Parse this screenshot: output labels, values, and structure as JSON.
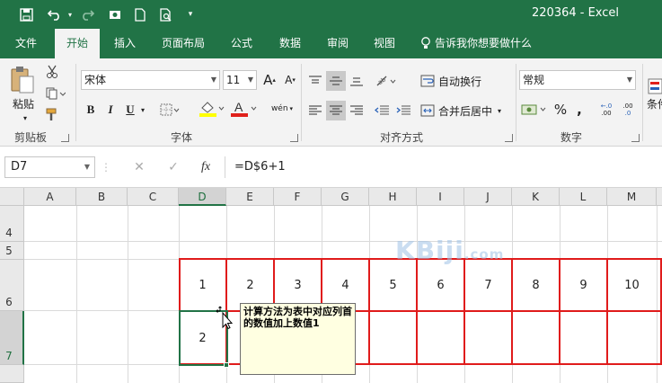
{
  "window": {
    "title": "220364 - Excel"
  },
  "quick_access": {
    "save_icon": "save-icon",
    "undo_icon": "undo-icon",
    "redo_icon": "redo-icon",
    "customize": "▾"
  },
  "tabs": [
    {
      "label": "文件"
    },
    {
      "label": "开始"
    },
    {
      "label": "插入"
    },
    {
      "label": "页面布局"
    },
    {
      "label": "公式"
    },
    {
      "label": "数据"
    },
    {
      "label": "审阅"
    },
    {
      "label": "视图"
    }
  ],
  "tell_me": "告诉我你想要做什么",
  "ribbon": {
    "clipboard": {
      "paste_label": "粘贴",
      "group_label": "剪贴板"
    },
    "font": {
      "name": "宋体",
      "size": "11",
      "bold": "B",
      "italic": "I",
      "underline": "U",
      "grow": "A",
      "shrink": "A",
      "phonetic": "wén",
      "group_label": "字体"
    },
    "alignment": {
      "wrap_text": "自动换行",
      "merge_center": "合并后居中",
      "group_label": "对齐方式"
    },
    "number": {
      "format": "常规",
      "percent": "%",
      "comma": ",",
      "inc_decimal": ".00",
      "dec_decimal": ".0",
      "group_label": "数字"
    },
    "styles": {
      "conditional_partial": "条件"
    }
  },
  "formula_bar": {
    "name_box": "D7",
    "fx": "fx",
    "formula": "=D$6+1"
  },
  "columns": [
    "A",
    "B",
    "C",
    "D",
    "E",
    "F",
    "G",
    "H",
    "I",
    "J",
    "K",
    "L",
    "M"
  ],
  "rows": [
    "4",
    "5",
    "6",
    "7"
  ],
  "selected": {
    "column": "D",
    "row": "7"
  },
  "cells": {
    "row6": [
      "1",
      "2",
      "3",
      "4",
      "5",
      "6",
      "7",
      "8",
      "9",
      "10"
    ],
    "D7": "2"
  },
  "comment": "计算方法为表中对应列首的数值加上数值1",
  "watermark": {
    "main": "KBiji",
    "suffix": ".com"
  },
  "colors": {
    "excel_green": "#217346",
    "border_red": "#e01b1b",
    "comment_bg": "#ffffe1"
  }
}
